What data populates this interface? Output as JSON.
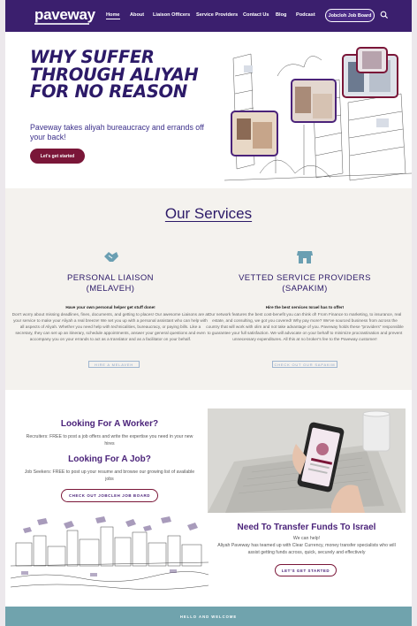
{
  "nav": {
    "logo": "paveway",
    "items": [
      "Home",
      "About",
      "Liaison Officers",
      "Service Providers",
      "Contact Us",
      "Blog",
      "Podcast"
    ],
    "cta": "Jobcloh Job Board"
  },
  "hero": {
    "title": "WHY SUFFER THROUGH ALIYAH FOR NO REASON",
    "subtitle": "Paveway takes aliyah bureaucracy and errands off your back!",
    "button": "Let's get started"
  },
  "services": {
    "title": "Our Services",
    "liaison": {
      "title_line1": "PERSONAL LIAISON",
      "title_line2": "(MELAVEH)",
      "lead": "Have your own personal helper get stuff done!",
      "body": "Don't worry about missing deadlines, fines, documents, and getting to places! Our awesome Liaisons are at your service to make your Aliyah a real breeze! We set you up with a personal assistant who can help with all aspects of Aliyah. Whether you need help with technicalities, bureaucracy, or paying bills. Like a secretary, they can set up an itinerary, schedule appointments, answer your general questions and even accompany you on your errands to act as a translator and as a facilitator on your behalf.",
      "link": "HIRE A MELAVEH"
    },
    "providers": {
      "title_line1": "VETTED SERVICE PROVIDERS",
      "title_line2": "(SAPAKIM)",
      "lead": "Hire the best services Israel has to offer!",
      "body": "Our network features the best cost-benefit you can think of! From Finance to marketing, to insurance, real estate, and consulting, we got you covered! Why pay more? We've sourced business from across the country that will work with olim and not take advantage of you. Paveway holds these \"providers\" responsible to guarantee your full satisfaction. We will advocate on your behalf to minimize procrastination and prevent unnecessary expenditures. All this at no broker's fee to the Paveway customer!",
      "link": "CHECK OUT OUR SAPAKIM"
    }
  },
  "jobs": {
    "worker_title": "Looking For A Worker?",
    "worker_text": "Recruiters: FREE to post a job offers and write the expertise you need in your new hires",
    "job_title": "Looking For A Job?",
    "job_text": "Job Seekers: FREE to post up your resume and browse our growing list of available jobs",
    "button": "CHECK OUT JOBCLEH JOB BOARD"
  },
  "transfer": {
    "title": "Need To Transfer Funds To Israel",
    "lead": "We can help!",
    "text": "Aliyah Paveway has teamed up with Clear Currency, money transfer specialists who will assist getting funds across, quick, securely and effectively",
    "button": "LET'S GET STARTED"
  },
  "footer": {
    "label": "HELLO AND WELCOME"
  },
  "colors": {
    "nav": "#3b1f6e",
    "accent": "#7a1638",
    "heading": "#2c1a68",
    "band": "#70a3ad"
  },
  "icons": [
    "search-icon",
    "handshake-icon",
    "storefront-icon"
  ]
}
